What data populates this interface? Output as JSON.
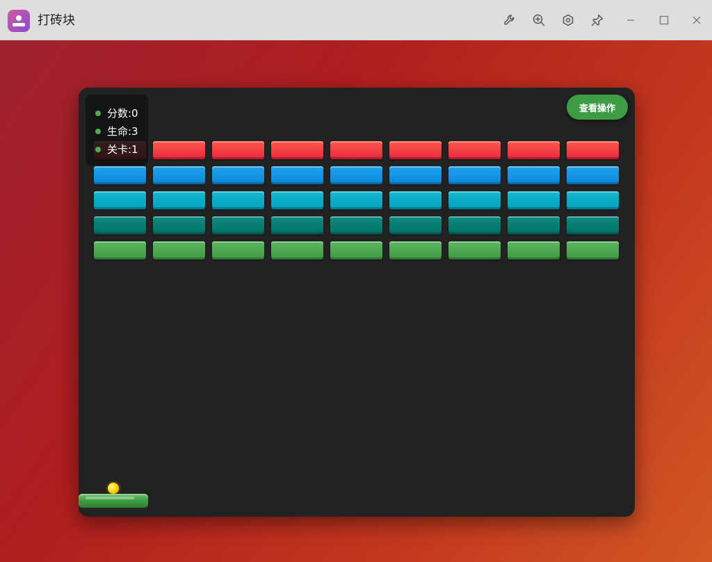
{
  "window": {
    "title": "打砖块",
    "icons": [
      "wrench-icon",
      "zoom-in-icon",
      "hexagon-settings-icon",
      "pin-icon",
      "minimize-icon",
      "maximize-icon",
      "close-icon"
    ]
  },
  "hud": {
    "score": "分数:0",
    "lives": "生命:3",
    "level": "关卡:1"
  },
  "ops_button": {
    "label": "查看操作"
  },
  "game": {
    "brick_rows": [
      {
        "color_top": "#ff5a4a",
        "color_bottom": "#e8243e"
      },
      {
        "color_top": "#1fa3f0",
        "color_bottom": "#0b86d8"
      },
      {
        "color_top": "#18b8d2",
        "color_bottom": "#00a0bd"
      },
      {
        "color_top": "#0e8d80",
        "color_bottom": "#006f63"
      },
      {
        "color_top": "#5cb660",
        "color_bottom": "#3e9a43"
      }
    ],
    "bricks_per_row": 9,
    "paddle_color": "#43a047",
    "ball_color": "#ffd600"
  }
}
